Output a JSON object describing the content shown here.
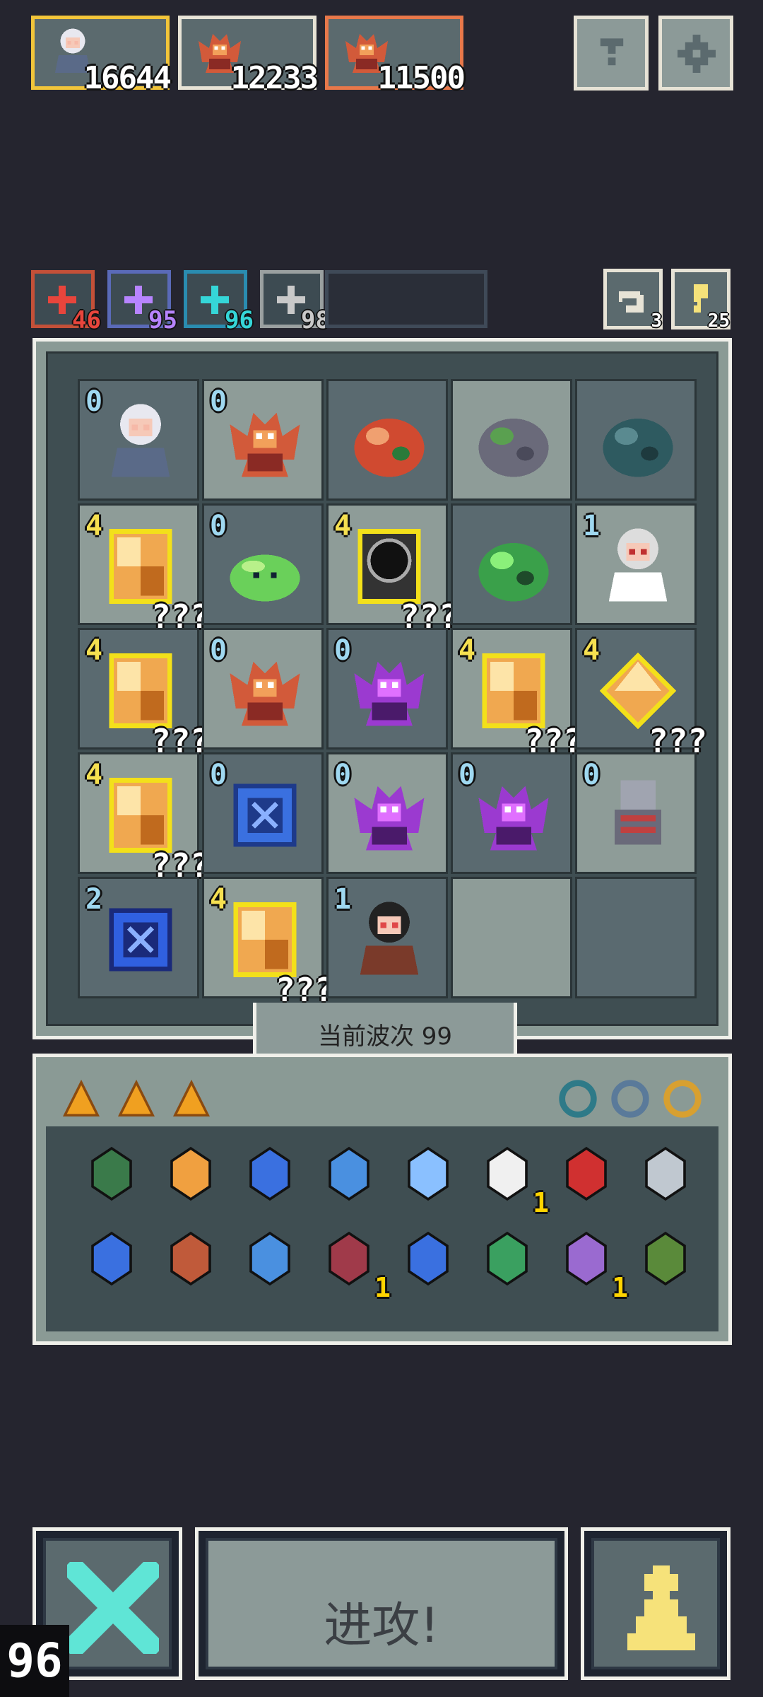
{
  "players": [
    {
      "name": "white-hair-girl",
      "score": "16644",
      "border": "#f2c53a"
    },
    {
      "name": "red-dragon",
      "score": "12233",
      "border": "#e7e3d6"
    },
    {
      "name": "red-dragon",
      "score": "11500",
      "border": "#e8784a"
    }
  ],
  "top_buttons": {
    "help": "help-icon",
    "settings": "gear-icon"
  },
  "resources": [
    {
      "icon": "plus-icon",
      "value": "46",
      "color": "#e8453c",
      "border": "#c45038"
    },
    {
      "icon": "lightning-icon",
      "value": "95",
      "color": "#b784ff",
      "border": "#5a6ab8"
    },
    {
      "icon": "spiral-icon",
      "value": "96",
      "color": "#35d6d8",
      "border": "#2a8cb0"
    },
    {
      "icon": "wing-icon",
      "value": "98",
      "color": "#c9c9c9",
      "border": "#9aa0a0"
    }
  ],
  "tools": [
    {
      "icon": "undo-icon",
      "value": "3"
    },
    {
      "icon": "key-icon",
      "value": "25"
    }
  ],
  "grid": [
    [
      {
        "unit": "white-hair-girl",
        "level": "0"
      },
      {
        "unit": "red-dragon",
        "level": "0"
      },
      {
        "unit": "crystal-plant",
        "level": ""
      },
      {
        "unit": "moss-rock",
        "level": ""
      },
      {
        "unit": "tentacle-beast",
        "level": ""
      }
    ],
    [
      {
        "unit": "mystery-box",
        "level": "4",
        "q": "???"
      },
      {
        "unit": "green-slime",
        "level": "0"
      },
      {
        "unit": "dark-portal",
        "level": "4",
        "q": "???"
      },
      {
        "unit": "green-golem",
        "level": ""
      },
      {
        "unit": "horned-sage",
        "level": "1"
      }
    ],
    [
      {
        "unit": "mystery-box",
        "level": "4",
        "q": "???"
      },
      {
        "unit": "red-dragon",
        "level": "0"
      },
      {
        "unit": "purple-dragon",
        "level": "0"
      },
      {
        "unit": "mystery-box",
        "level": "4",
        "q": "???"
      },
      {
        "unit": "mystery-gem",
        "level": "4",
        "q": "???"
      }
    ],
    [
      {
        "unit": "mystery-box",
        "level": "4",
        "q": "???"
      },
      {
        "unit": "blue-rune-cube",
        "level": "0"
      },
      {
        "unit": "purple-dragon",
        "level": "0"
      },
      {
        "unit": "purple-dragon",
        "level": "0"
      },
      {
        "unit": "armored-knight",
        "level": "0"
      }
    ],
    [
      {
        "unit": "blue-clock-lantern",
        "level": "2"
      },
      {
        "unit": "mystery-box",
        "level": "4",
        "q": "???"
      },
      {
        "unit": "demon-girl",
        "level": "1"
      },
      {
        "unit": "",
        "level": ""
      },
      {
        "unit": "",
        "level": ""
      }
    ]
  ],
  "wave_label": "当前波次 99",
  "inventory_tabs": [
    "cheese-icon",
    "cheese-icon",
    "cheese-icon"
  ],
  "inventory_side_icons": [
    "ring-icon",
    "potion-jar-icon",
    "amulet-icon"
  ],
  "inventory": [
    {
      "icon": "turtle-shell-icon",
      "count": ""
    },
    {
      "icon": "scroll-icon",
      "count": ""
    },
    {
      "icon": "goggles-icon",
      "count": ""
    },
    {
      "icon": "blue-wind-icon",
      "count": ""
    },
    {
      "icon": "ice-crystal-icon",
      "count": ""
    },
    {
      "icon": "white-wing-icon",
      "count": "1"
    },
    {
      "icon": "water-drop-card-icon",
      "count": ""
    },
    {
      "icon": "silver-swirl-icon",
      "count": ""
    },
    {
      "icon": "blue-drop-icon",
      "count": ""
    },
    {
      "icon": "arrow-icon",
      "count": ""
    },
    {
      "icon": "blue-feather-icon",
      "count": ""
    },
    {
      "icon": "dragon-medal-icon",
      "count": "1"
    },
    {
      "icon": "blue-ghost-icon",
      "count": ""
    },
    {
      "icon": "green-leaf-icon",
      "count": ""
    },
    {
      "icon": "potion-bottle-icon",
      "count": "1"
    },
    {
      "icon": "grass-block-icon",
      "count": ""
    }
  ],
  "bottom": {
    "attack_label": "进攻!",
    "left_count": "96"
  },
  "colors": {
    "background": "#25252f",
    "teal_x": "#5fe5d6",
    "pawn_yellow": "#f6e27a"
  }
}
